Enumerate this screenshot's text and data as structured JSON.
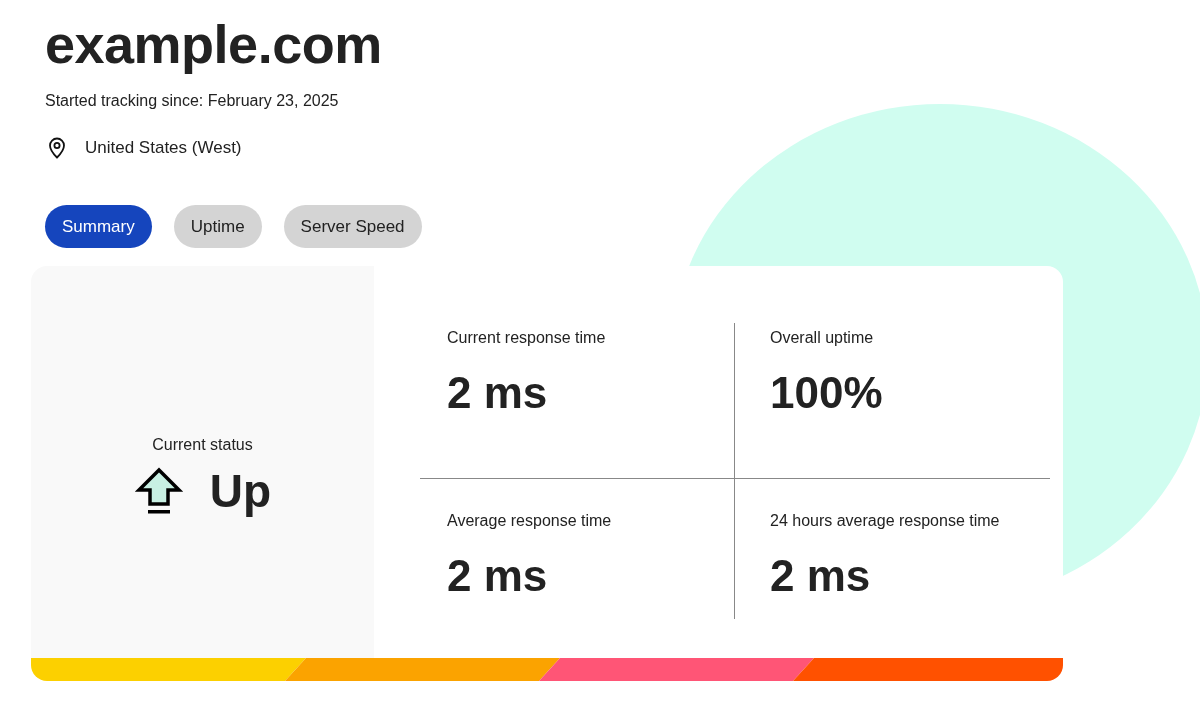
{
  "site": {
    "title": "example.com",
    "tracking_since": "Started tracking since: February 23, 2025",
    "location": "United States (West)"
  },
  "tabs": [
    {
      "label": "Summary",
      "selected": true
    },
    {
      "label": "Uptime",
      "selected": false
    },
    {
      "label": "Server Speed",
      "selected": false
    }
  ],
  "status": {
    "label": "Current status",
    "value": "Up"
  },
  "metrics": [
    {
      "label": "Current response time",
      "value": "2 ms"
    },
    {
      "label": "Overall uptime",
      "value": "100%"
    },
    {
      "label": "Average response time",
      "value": "2 ms"
    },
    {
      "label": "24 hours average response time",
      "value": "2 ms"
    }
  ]
}
